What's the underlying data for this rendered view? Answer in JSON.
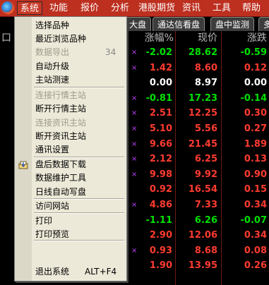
{
  "menubar": {
    "items": [
      "系统",
      "功能",
      "报价",
      "分析",
      "港股期货",
      "资讯",
      "工具",
      "帮助"
    ]
  },
  "tabs": [
    "大盘",
    "通达信看盘",
    "盘中监测",
    "多"
  ],
  "columns": {
    "left_marker": "口",
    "change_pct": "涨幅%",
    "price": "现价",
    "change": "涨跌"
  },
  "system_menu": {
    "items": [
      {
        "label": "选择品种",
        "disabled": false
      },
      {
        "label": "最近浏览品种",
        "disabled": false
      },
      {
        "label": "数据导出",
        "disabled": true,
        "shortcut": "34"
      },
      {
        "label": "自动升级",
        "disabled": false
      },
      {
        "label": "主站测速",
        "disabled": false
      },
      {
        "label": "连接行情主站",
        "disabled": true
      },
      {
        "label": "断开行情主站",
        "disabled": false
      },
      {
        "label": "连接资讯主站",
        "disabled": true
      },
      {
        "label": "断开资讯主站",
        "disabled": false
      },
      {
        "label": "通讯设置",
        "disabled": false
      },
      {
        "label": "盘后数据下载",
        "disabled": false,
        "icon": "download-icon"
      },
      {
        "label": "数据维护工具",
        "disabled": false
      },
      {
        "label": "日线自动写盘",
        "disabled": false
      },
      {
        "label": "访问网站",
        "disabled": false
      },
      {
        "label": "打印",
        "disabled": false
      },
      {
        "label": "打印预览",
        "disabled": false
      },
      {
        "label": "退出系统",
        "disabled": false,
        "shortcut": "ALT+F4"
      }
    ]
  },
  "rows": [
    {
      "mark": true,
      "change_pct": "-2.02",
      "price": "28.62",
      "change": "-0.59",
      "color": "green"
    },
    {
      "mark": true,
      "change_pct": "1.42",
      "price": "8.60",
      "change": "0.12",
      "color": "red"
    },
    {
      "mark": false,
      "change_pct": "0.00",
      "price": "8.97",
      "change": "0.00",
      "color": "white"
    },
    {
      "mark": true,
      "change_pct": "-0.81",
      "price": "17.23",
      "change": "-0.14",
      "color": "green"
    },
    {
      "mark": true,
      "change_pct": "2.51",
      "price": "12.25",
      "change": "0.30",
      "color": "red"
    },
    {
      "mark": true,
      "change_pct": "5.10",
      "price": "5.56",
      "change": "0.27",
      "color": "red"
    },
    {
      "mark": true,
      "change_pct": "9.66",
      "price": "21.45",
      "change": "1.89",
      "color": "red"
    },
    {
      "mark": true,
      "change_pct": "2.12",
      "price": "6.25",
      "change": "0.13",
      "color": "red"
    },
    {
      "mark": true,
      "change_pct": "9.98",
      "price": "9.92",
      "change": "0.90",
      "color": "red"
    },
    {
      "mark": false,
      "change_pct": "0.92",
      "price": "16.54",
      "change": "0.15",
      "color": "red"
    },
    {
      "mark": true,
      "change_pct": "4.86",
      "price": "7.33",
      "change": "0.34",
      "color": "red"
    },
    {
      "mark": false,
      "change_pct": "-1.11",
      "price": "6.26",
      "change": "-0.07",
      "color": "green"
    },
    {
      "mark": false,
      "change_pct": "2.90",
      "price": "12.06",
      "change": "0.34",
      "color": "red"
    },
    {
      "mark": true,
      "change_pct": "0.93",
      "price": "8.68",
      "change": "0.08",
      "color": "red"
    },
    {
      "mark": false,
      "change_pct": "1.90",
      "price": "13.95",
      "change": "0.26",
      "color": "red"
    }
  ],
  "colors": {
    "red": "#ff3b30",
    "green": "#00e000",
    "white": "#ffffff",
    "menubar": "#bd2f1f"
  }
}
